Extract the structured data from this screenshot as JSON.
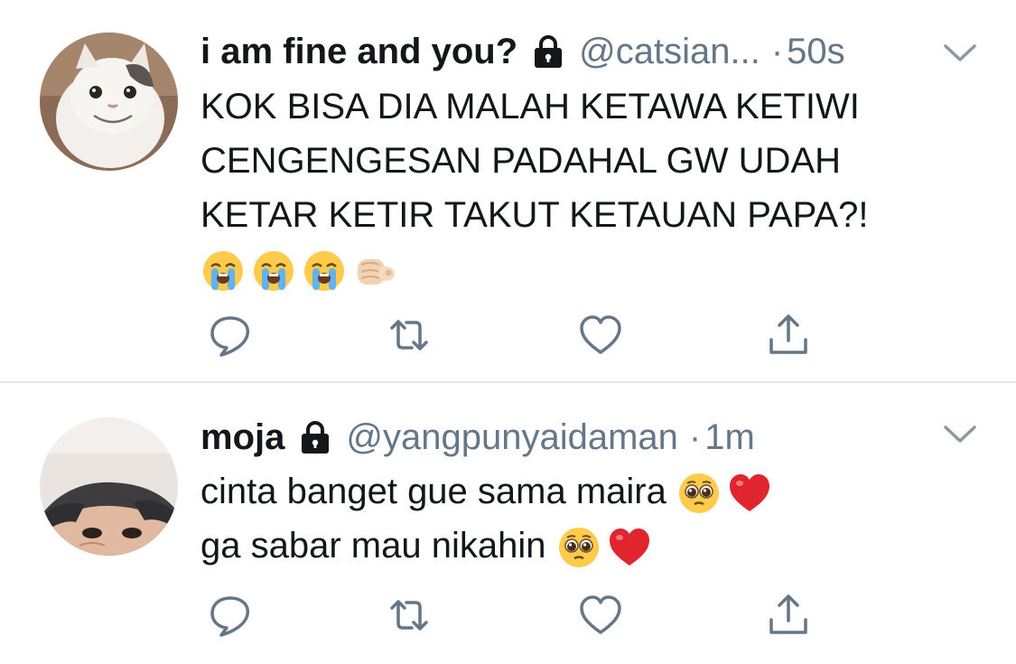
{
  "tweets": [
    {
      "display_name": "i am fine and you?",
      "handle": "@catsian...",
      "separator": "·",
      "time": "50s",
      "body_lines": [
        "KOK BISA DIA MALAH KETAWA KETIWI",
        "CENGENGESAN PADAHAL GW UDAH",
        "KETAR KETIR TAKUT KETAUAN PAPA?!"
      ],
      "emojis": [
        "loudly-crying-face",
        "loudly-crying-face",
        "loudly-crying-face",
        "pointing-at-viewer-hand"
      ],
      "avatar": "smiling-cat-photo",
      "protected_icon": "lock-icon"
    },
    {
      "display_name": "moja",
      "handle": "@yangpunyaidaman",
      "separator": "·",
      "time": "1m",
      "body_lines": [
        "cinta banget gue sama maira",
        "ga sabar mau nikahin"
      ],
      "line_emojis": [
        [
          "pleading-face",
          "red-heart"
        ],
        [
          "pleading-face",
          "red-heart"
        ]
      ],
      "avatar": "person-face-photo",
      "protected_icon": "lock-icon"
    }
  ],
  "action_icons": [
    "reply-icon",
    "retweet-icon",
    "like-icon",
    "share-icon"
  ],
  "colors": {
    "text": "#14171a",
    "secondary": "#657786",
    "divider": "#e1e8ed",
    "icon": "#657786"
  }
}
